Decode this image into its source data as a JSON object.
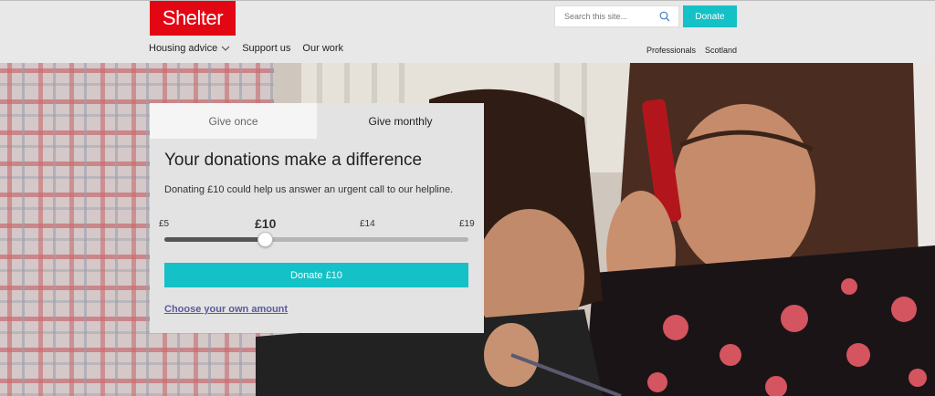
{
  "brand": {
    "logo_text": "Shelter",
    "accent": "#e30613",
    "teal": "#14c1c6"
  },
  "header": {
    "search_placeholder": "Search this site...",
    "donate_label": "Donate",
    "nav": [
      "Housing advice",
      "Support us",
      "Our work"
    ],
    "nav_right": [
      "Professionals",
      "Scotland"
    ]
  },
  "widget": {
    "tabs": [
      {
        "label": "Give once",
        "active": false
      },
      {
        "label": "Give monthly",
        "active": true
      }
    ],
    "title": "Your donations make a difference",
    "description": "Donating £10 could help us answer an urgent call to our helpline.",
    "amounts": [
      "£5",
      "£10",
      "£14",
      "£19"
    ],
    "selected_amount": "£10",
    "slider_value_fraction": 0.33,
    "donate_button": "Donate £10",
    "own_amount_link": "Choose your own amount"
  }
}
